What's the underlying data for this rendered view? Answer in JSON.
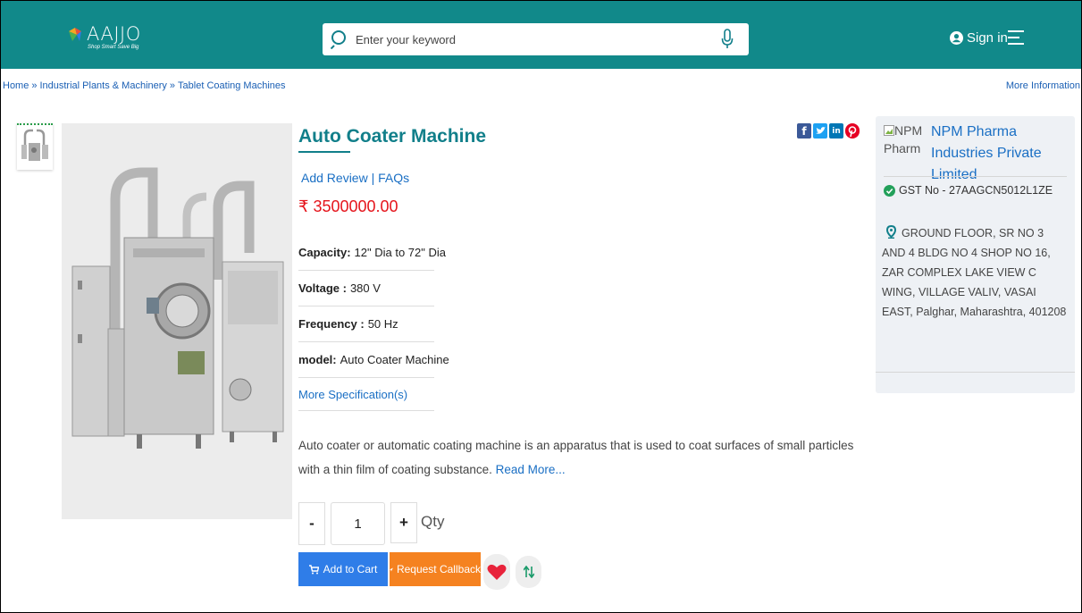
{
  "header": {
    "logo_text": "AAJJO",
    "logo_tagline": "Shop Smart Save Big",
    "search_placeholder": "Enter your keyword",
    "signin_label": "Sign in",
    "colors": {
      "bar": "#11898a"
    }
  },
  "breadcrumb": {
    "items": [
      "Home",
      "Industrial Plants & Machinery",
      "Tablet Coating Machines"
    ],
    "separator": "»",
    "more_info": "More Information"
  },
  "product": {
    "title": "Auto Coater Machine",
    "add_review": "Add Review",
    "link_sep": "|",
    "faqs": "FAQs",
    "price": "₹ 3500000.00",
    "specs": [
      {
        "label": "Capacity:",
        "value": "12\" Dia to 72\" Dia"
      },
      {
        "label": "Voltage :",
        "value": "380 V"
      },
      {
        "label": "Frequency :",
        "value": "50 Hz"
      },
      {
        "label": "model:",
        "value": "Auto Coater Machine"
      }
    ],
    "more_specs": "More Specification(s)",
    "description": "Auto coater or automatic coating machine is an apparatus that is used to coat surfaces of small particles with a thin film of coating substance.",
    "read_more": "Read More...",
    "qty_value": "1",
    "qty_minus": "-",
    "qty_plus": "+",
    "qty_label": "Qty",
    "add_to_cart": "Add to Cart",
    "request_callback": "Request Callback",
    "share_icons": [
      "facebook-icon",
      "twitter-icon",
      "linkedin-icon",
      "pinterest-icon"
    ]
  },
  "seller": {
    "logo_alt": "NPM Pharm",
    "name": "NPM Pharma Industries Private Limited",
    "gst": "GST No - 27AAGCN5012L1ZE",
    "address": "GROUND FLOOR, SR NO 3 AND 4 BLDG NO 4 SHOP NO 16, ZAR COMPLEX LAKE VIEW C WING, VILLAGE VALIV, VASAI EAST, Palghar, Maharashtra, 401208"
  }
}
